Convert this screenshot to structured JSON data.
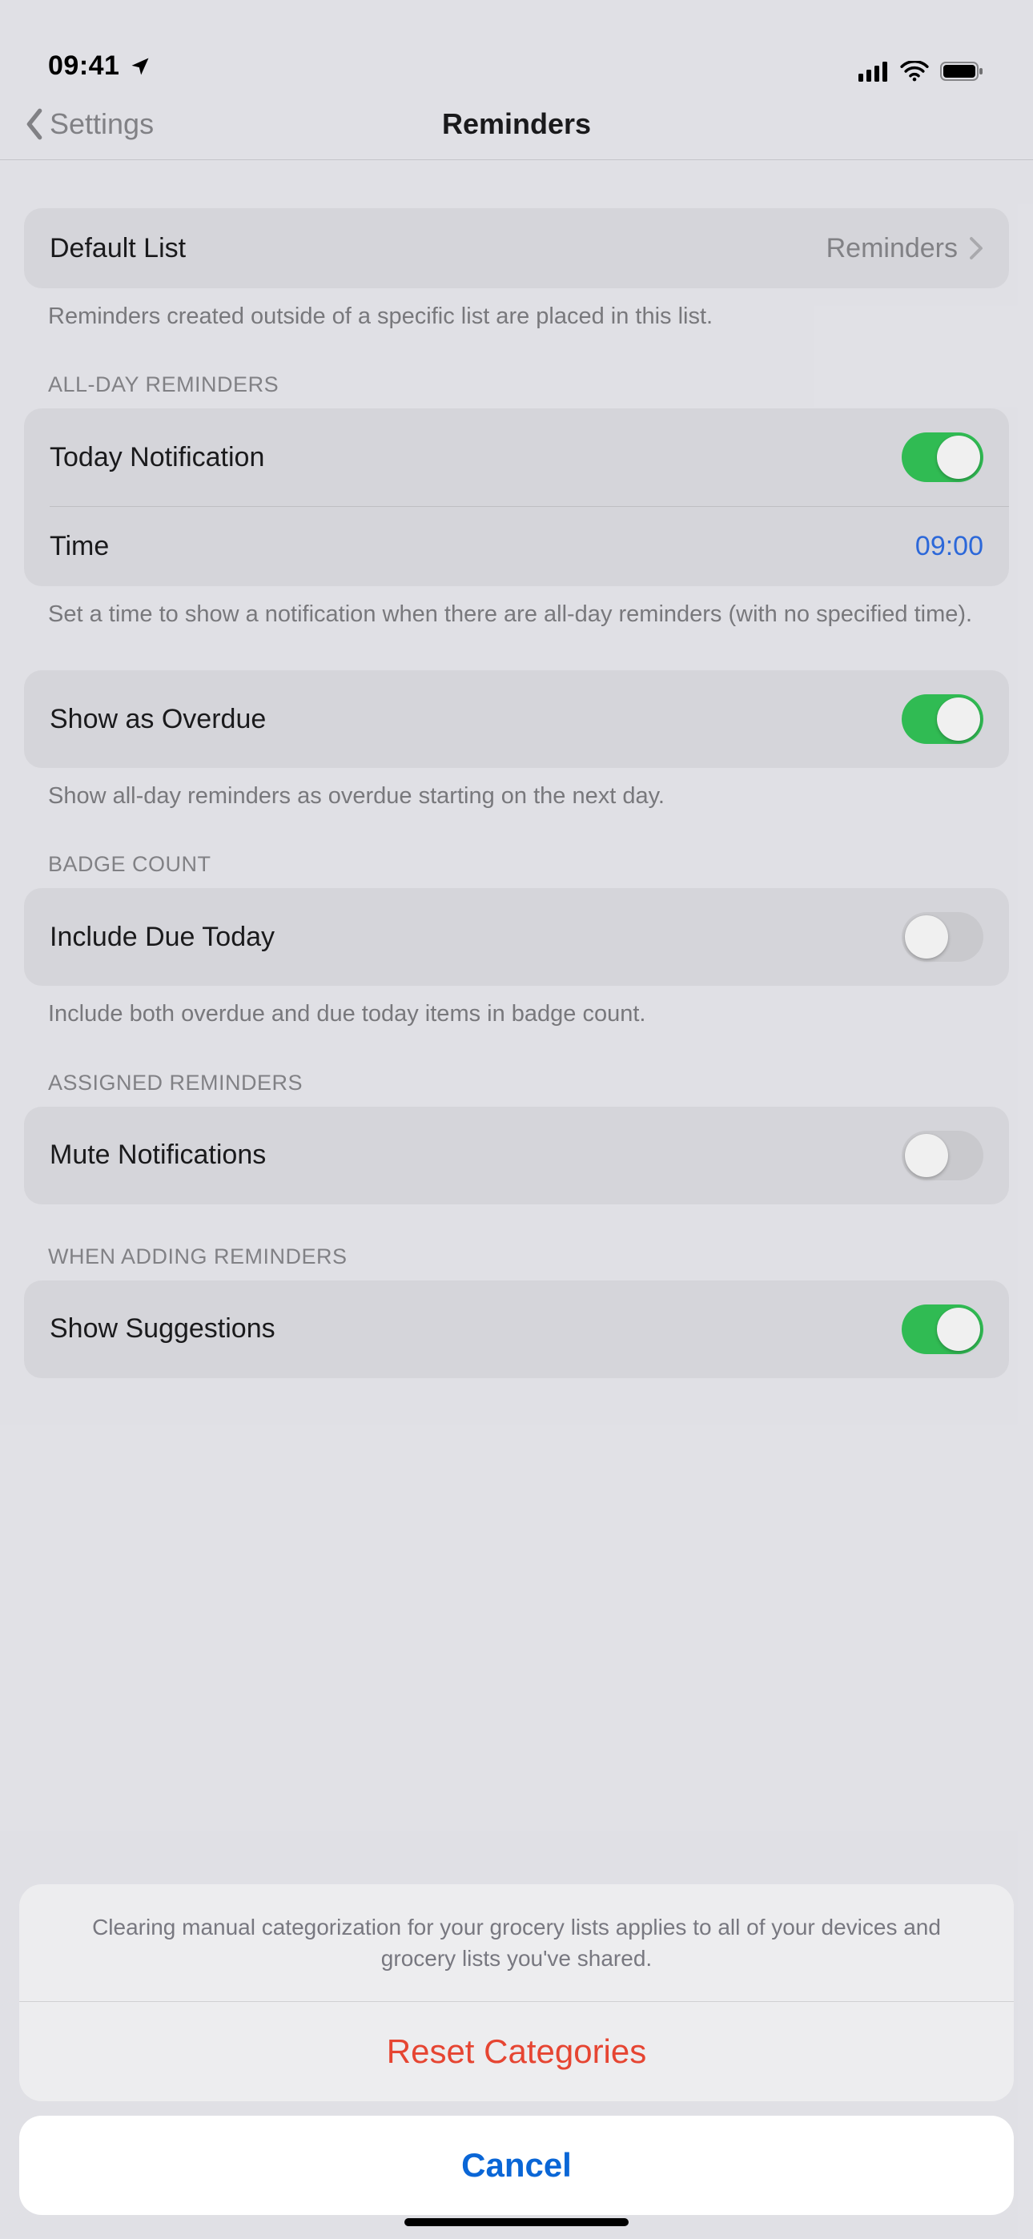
{
  "status": {
    "time": "09:41",
    "location_icon": "location-arrow",
    "cellular_icon": "cellular-bars",
    "wifi_icon": "wifi",
    "battery_icon": "battery-full"
  },
  "nav": {
    "back_label": "Settings",
    "title": "Reminders"
  },
  "groups": {
    "default_list": {
      "label": "Default List",
      "value": "Reminders",
      "footer": "Reminders created outside of a specific list are placed in this list."
    },
    "all_day": {
      "header": "ALL-DAY REMINDERS",
      "today_notification_label": "Today Notification",
      "today_notification_on": true,
      "time_label": "Time",
      "time_value": "09:00",
      "footer": "Set a time to show a notification when there are all-day reminders (with no specified time)."
    },
    "overdue": {
      "label": "Show as Overdue",
      "on": true,
      "footer": "Show all-day reminders as overdue starting on the next day."
    },
    "badge": {
      "header": "BADGE COUNT",
      "include_due_today_label": "Include Due Today",
      "include_due_today_on": false,
      "footer": "Include both overdue and due today items in badge count."
    },
    "assigned": {
      "header": "ASSIGNED REMINDERS",
      "mute_label": "Mute Notifications",
      "mute_on": false
    },
    "adding": {
      "header": "WHEN ADDING REMINDERS",
      "show_suggestions_label": "Show Suggestions",
      "show_suggestions_on": true
    }
  },
  "sheet": {
    "message": "Clearing manual categorization for your grocery lists applies to all of your devices and grocery lists you've shared.",
    "destructive_label": "Reset Categories",
    "cancel_label": "Cancel"
  }
}
